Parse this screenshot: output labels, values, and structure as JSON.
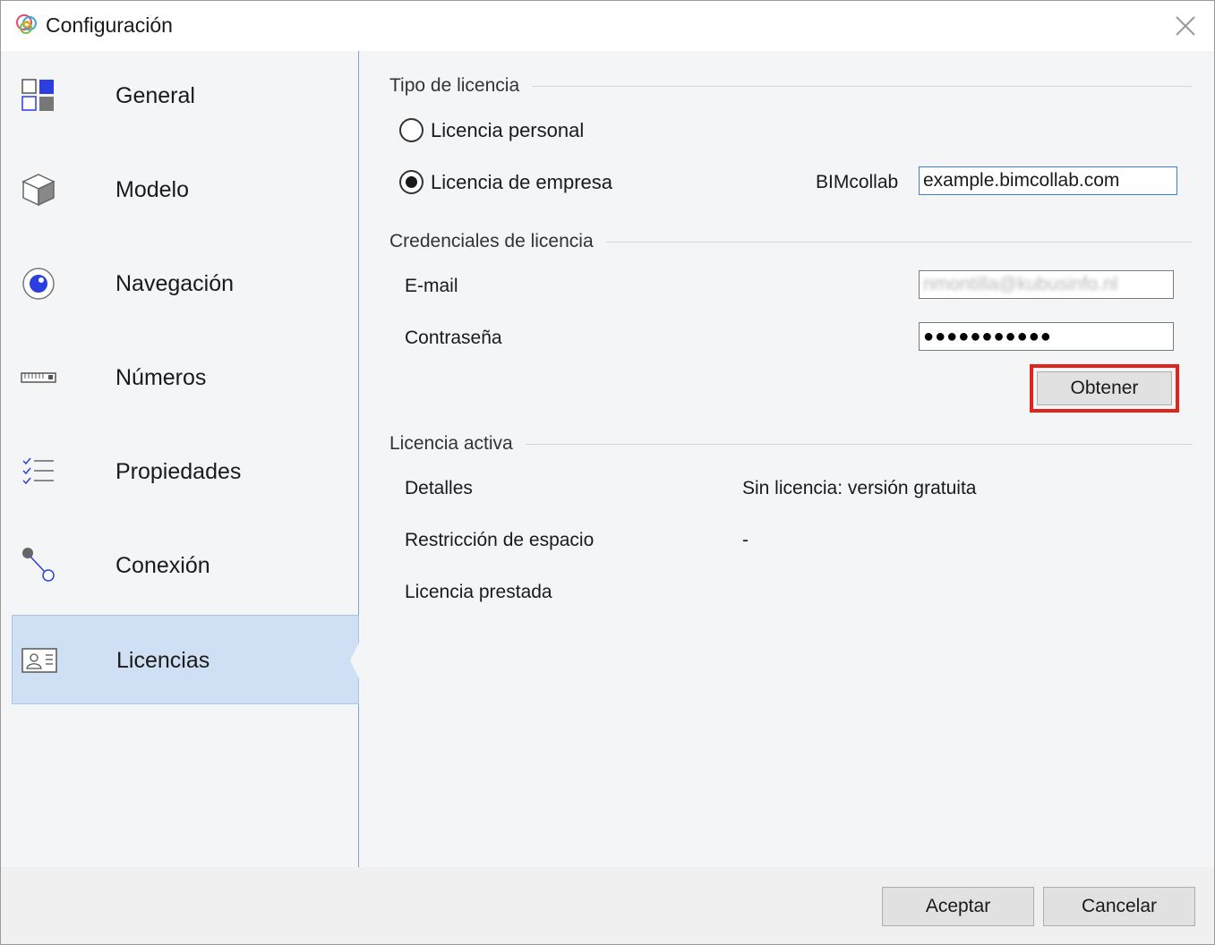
{
  "window": {
    "title": "Configuración"
  },
  "sidebar": {
    "items": [
      {
        "label": "General",
        "icon": "general-grid-icon"
      },
      {
        "label": "Modelo",
        "icon": "cube-icon"
      },
      {
        "label": "Navegación",
        "icon": "navigation-eye-icon"
      },
      {
        "label": "Números",
        "icon": "ruler-icon"
      },
      {
        "label": "Propiedades",
        "icon": "checklist-icon"
      },
      {
        "label": "Conexión",
        "icon": "connection-icon"
      },
      {
        "label": "Licencias",
        "icon": "id-card-icon",
        "active": true
      }
    ]
  },
  "license_type": {
    "heading": "Tipo de licencia",
    "personal_label": "Licencia personal",
    "company_label": "Licencia de empresa",
    "selected": "company",
    "bimcollab_label": "BIMcollab",
    "bimcollab_value": "example.bimcollab.com"
  },
  "credentials": {
    "heading": "Credenciales de licencia",
    "email_label": "E-mail",
    "email_value": "nmontilla@kubusinfo.nl",
    "password_label": "Contraseña",
    "password_value": "●●●●●●●●●●●",
    "obtain_button": "Obtener"
  },
  "active_license": {
    "heading": "Licencia activa",
    "details_label": "Detalles",
    "details_value": "Sin licencia: versión gratuita",
    "space_label": "Restricción de espacio",
    "space_value": "-",
    "borrowed_label": "Licencia prestada"
  },
  "footer": {
    "accept_button": "Aceptar",
    "cancel_button": "Cancelar"
  },
  "colors": {
    "accent_blue": "#2b3ee0",
    "selection": "#cfe0f5",
    "highlight_red": "#e0241b"
  }
}
